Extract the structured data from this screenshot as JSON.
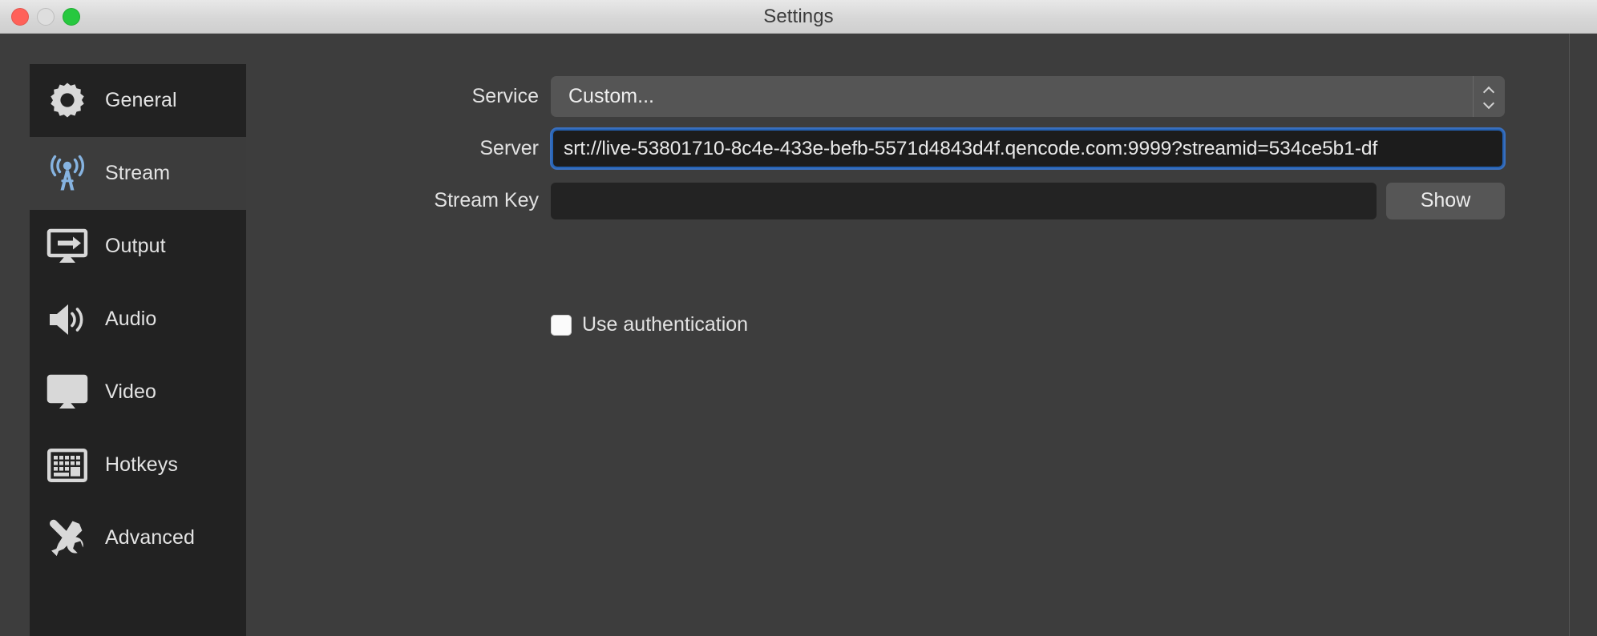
{
  "window": {
    "title": "Settings",
    "traffic_lights": [
      {
        "name": "close",
        "color": "#ff6159"
      },
      {
        "name": "minimize",
        "color": "#dedede"
      },
      {
        "name": "maximize",
        "color": "#27c83f"
      }
    ]
  },
  "sidebar": {
    "items": [
      {
        "label": "General",
        "icon": "gear-icon",
        "selected": false
      },
      {
        "label": "Stream",
        "icon": "broadcast-icon",
        "selected": true
      },
      {
        "label": "Output",
        "icon": "monitor-arrow-icon",
        "selected": false
      },
      {
        "label": "Audio",
        "icon": "speaker-icon",
        "selected": false
      },
      {
        "label": "Video",
        "icon": "display-icon",
        "selected": false
      },
      {
        "label": "Hotkeys",
        "icon": "keyboard-icon",
        "selected": false
      },
      {
        "label": "Advanced",
        "icon": "wrench-screwdriver-icon",
        "selected": false
      }
    ]
  },
  "stream_settings": {
    "service": {
      "label": "Service",
      "value": "Custom...",
      "stepper_icon": "up-down-chevron-icon"
    },
    "server": {
      "label": "Server",
      "value": "srt://live-53801710-8c4e-433e-befb-5571d4843d4f.qencode.com:9999?streamid=534ce5b1-df",
      "focused": true,
      "focus_color": "#2563b5"
    },
    "stream_key": {
      "label": "Stream Key",
      "value": "",
      "show_button_label": "Show"
    },
    "use_authentication": {
      "label": "Use authentication",
      "checked": false
    }
  },
  "colors": {
    "window_bg": "#3d3d3d",
    "sidebar_bg": "#222222",
    "sidebar_selected_bg": "#3c3c3c",
    "accent_blue": "#2563b5",
    "stream_icon_blue": "#86b3e0",
    "titlebar_text": "#3b3b3b"
  }
}
